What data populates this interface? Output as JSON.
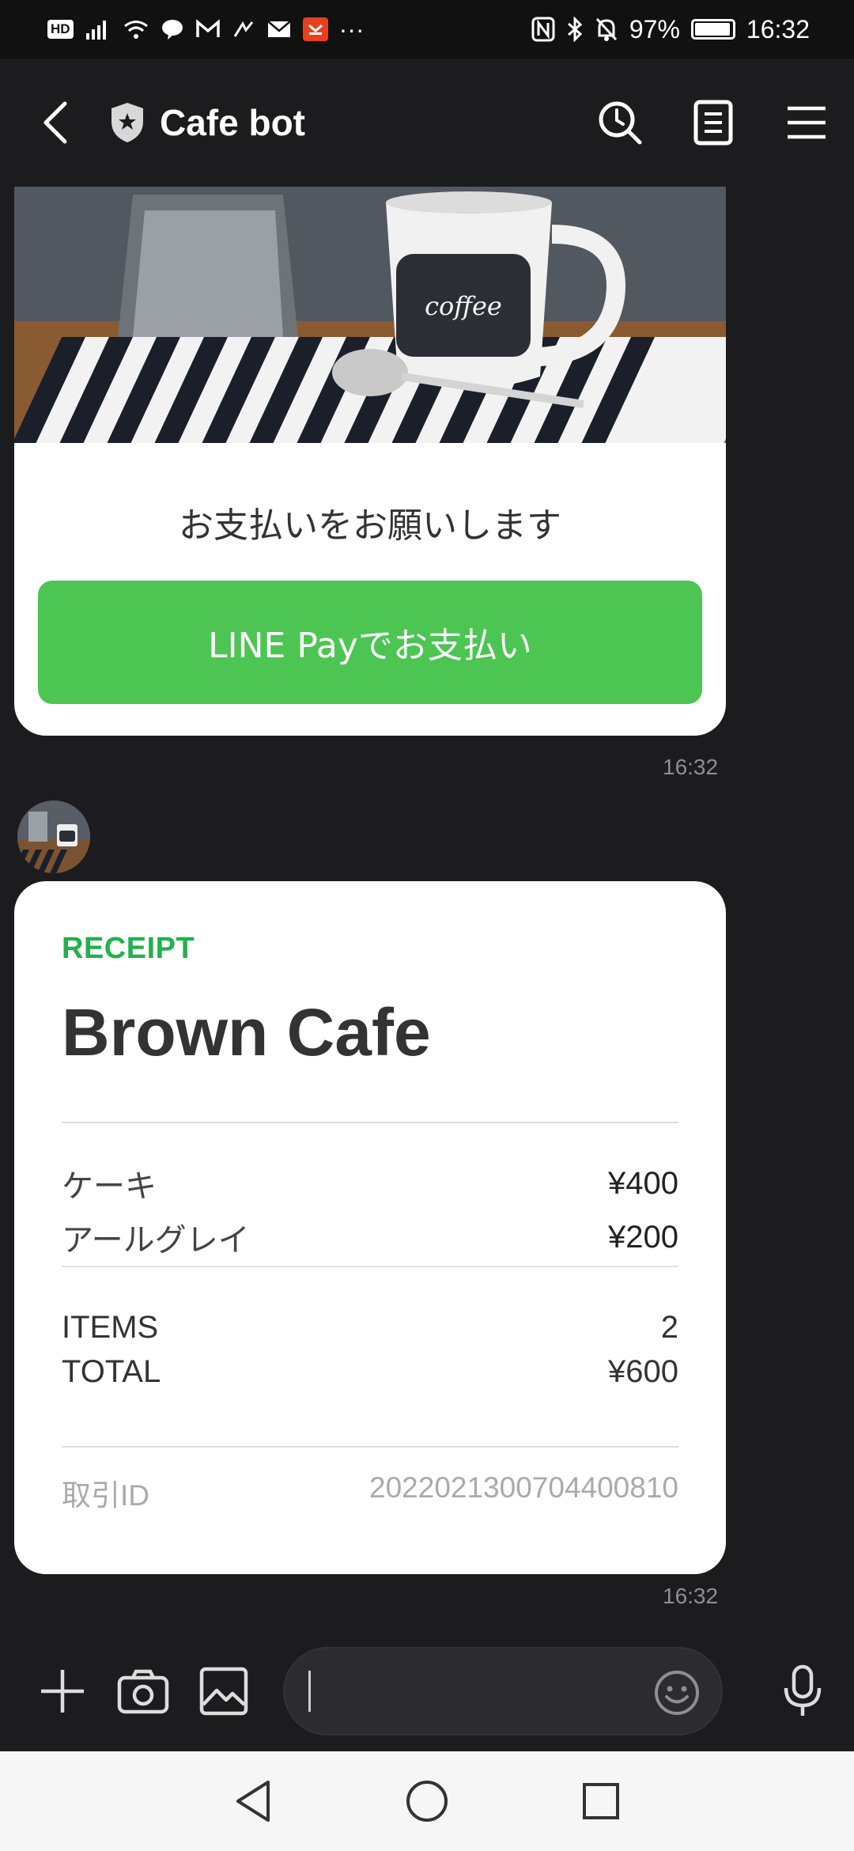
{
  "status_bar": {
    "left_badge": "HD",
    "battery": "97%",
    "battery_level": 0.97,
    "time": "16:32",
    "more": "···"
  },
  "header": {
    "title": "Cafe bot",
    "icons": [
      "chevron-left-icon",
      "shield-icon",
      "clock-search-icon",
      "notes-icon",
      "menu-icon"
    ]
  },
  "messages": {
    "payment_card": {
      "hero_text": "coffee",
      "prompt": "お支払いをお願いします",
      "button_label": "LINE Payでお支払い",
      "time": "16:32"
    },
    "receipt_card": {
      "label": "RECEIPT",
      "shop": "Brown Cafe",
      "items": [
        {
          "name": "ケーキ",
          "price": "¥400"
        },
        {
          "name": "アールグレイ",
          "price": "¥200"
        }
      ],
      "summary": [
        {
          "name": "ITEMS",
          "value": "2"
        },
        {
          "name": "TOTAL",
          "value": "¥600"
        }
      ],
      "transaction_label": "取引ID",
      "transaction_id": "2022021300704400810",
      "time": "16:32"
    }
  },
  "input_bar": {
    "value": "",
    "icons": [
      "plus-icon",
      "camera-icon",
      "image-icon",
      "emoji-icon",
      "microphone-icon"
    ]
  },
  "colors": {
    "accent_green": "#4cc553",
    "receipt_green": "#22b14c",
    "background": "#1c1c1e"
  }
}
